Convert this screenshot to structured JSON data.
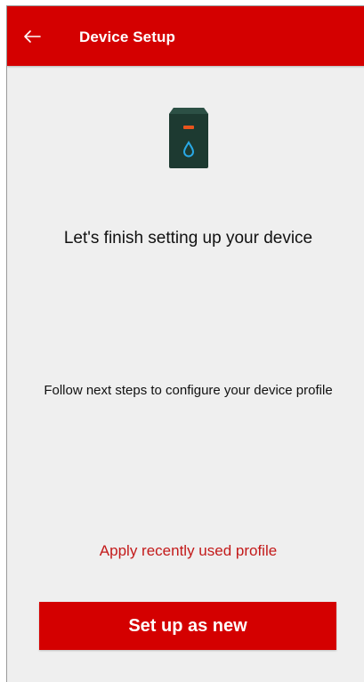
{
  "appbar": {
    "title": "Device Setup",
    "back_icon": "arrow-left-icon",
    "color": "#d40000"
  },
  "device": {
    "icon": "water-sensor-device-icon",
    "body_color": "#1d3a31",
    "led_color": "#e8541d",
    "drop_color": "#29a9e6"
  },
  "main": {
    "heading": "Let's finish setting up your device",
    "subtext": "Follow next steps to configure your device profile",
    "apply_profile_link": "Apply recently used profile",
    "setup_new_button": "Set up as new"
  }
}
